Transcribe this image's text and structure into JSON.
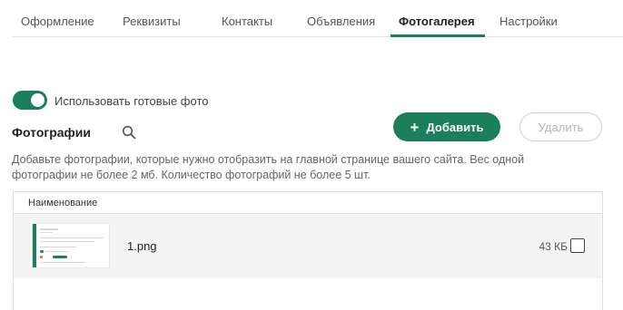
{
  "tabs": [
    {
      "label": "Оформление"
    },
    {
      "label": "Реквизиты"
    },
    {
      "label": "Контакты"
    },
    {
      "label": "Объявления"
    },
    {
      "label": "Фотогалерея",
      "active": true
    },
    {
      "label": "Настройки"
    }
  ],
  "toggle": {
    "label": "Использовать готовые фото",
    "on": true
  },
  "photos": {
    "title": "Фотографии",
    "add_label": "Добавить",
    "delete_label": "Удалить",
    "hint": "Добавьте фотографии, которые нужно отобразить на главной странице вашего сайта. Вес одной фотографии не более 2 мб. Количество фотографий не более 5 шт."
  },
  "table": {
    "header": "Наименование",
    "rows": [
      {
        "name": "1.png",
        "size": "43 КБ",
        "checked": false
      }
    ]
  },
  "icons": {
    "search": "search-icon",
    "add": "plus-icon",
    "checkbox": "checkbox-icon"
  },
  "colors": {
    "accent": "#1a7f5a",
    "row_bg": "#f4f4f4"
  }
}
